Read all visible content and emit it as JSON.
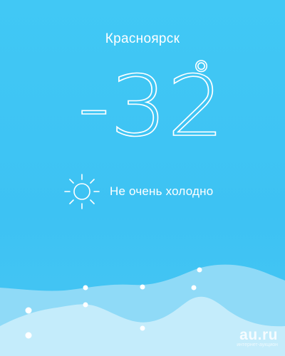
{
  "weather": {
    "city": "Красноярск",
    "temperature": "-32",
    "degree_symbol": "°",
    "condition": "Не очень холодно",
    "condition_icon": "sun-icon"
  },
  "watermark": {
    "text": "au.ru",
    "subtext": "интернет-аукцион"
  },
  "colors": {
    "background": "#41c8f5",
    "wave_back": "#8fdaf7",
    "wave_front": "#c4ecfb",
    "text": "#ffffff"
  }
}
